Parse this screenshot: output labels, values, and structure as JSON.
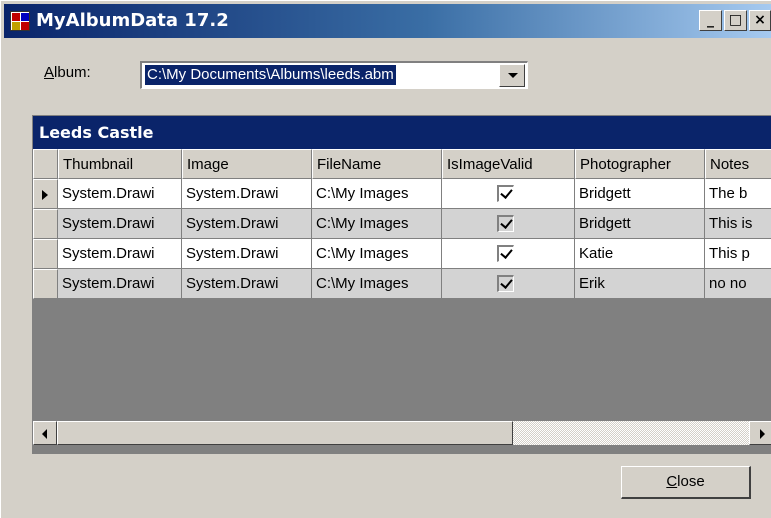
{
  "window": {
    "title": "MyAlbumData 17.2",
    "minimize_glyph": "_",
    "maximize_glyph": "□",
    "close_glyph": "×"
  },
  "album": {
    "label_accel": "A",
    "label_rest": "lbum:",
    "value": "C:\\My Documents\\Albums\\leeds.abm"
  },
  "grid": {
    "caption": "Leeds Castle",
    "columns": [
      "Thumbnail",
      "Image",
      "FileName",
      "IsImageValid",
      "Photographer",
      "Notes"
    ],
    "rows": [
      {
        "thumbnail": "System.Drawi",
        "image": "System.Drawi",
        "filename": "C:\\My Images",
        "is_image_valid": true,
        "photographer": "Bridgett",
        "notes": "The b"
      },
      {
        "thumbnail": "System.Drawi",
        "image": "System.Drawi",
        "filename": "C:\\My Images",
        "is_image_valid": true,
        "photographer": "Bridgett",
        "notes": "This is"
      },
      {
        "thumbnail": "System.Drawi",
        "image": "System.Drawi",
        "filename": "C:\\My Images",
        "is_image_valid": true,
        "photographer": "Katie",
        "notes": "This p"
      },
      {
        "thumbnail": "System.Drawi",
        "image": "System.Drawi",
        "filename": "C:\\My Images",
        "is_image_valid": true,
        "photographer": "Erik",
        "notes": "no no"
      }
    ],
    "current_row": 0
  },
  "buttons": {
    "close_accel": "C",
    "close_rest": "lose"
  },
  "colors": {
    "titlebar_start": "#0a246a",
    "titlebar_end": "#a6caf0",
    "caption_bg": "#0a246a",
    "face": "#d4d0c8",
    "grid_bg": "#808080",
    "alt_row": "#d3d3d3"
  },
  "icons": {
    "app": "app-window-icon",
    "row_selector": "current-row-arrow-icon",
    "check": "checkmark-icon"
  }
}
